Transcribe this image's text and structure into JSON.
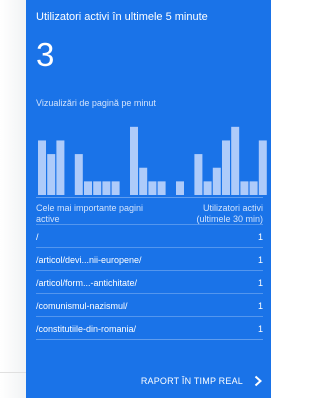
{
  "realtime": {
    "title": "Utilizatori activi în ultimele 5 minute",
    "count": "3",
    "pageviews_title": "Vizualizări de pagină pe minut",
    "table": {
      "col_left": "Cele mai importante pagini active",
      "col_right": "Utilizatori activi (ultimele 30 min)",
      "rows": [
        {
          "page": "/",
          "users": "1"
        },
        {
          "page": "/articol/devi...nii-europene/",
          "users": "1"
        },
        {
          "page": "/articol/form...-antichitate/",
          "users": "1"
        },
        {
          "page": "/comunismul-nazismul/",
          "users": "1"
        },
        {
          "page": "/constitutiile-din-romania/",
          "users": "1"
        }
      ]
    },
    "report_link": "RAPORT ÎN TIMP REAL"
  },
  "colors": {
    "card_bg": "#1a73e8",
    "bar": "#aecbfa",
    "text": "#ffffff",
    "muted_text": "#d2e3fc"
  },
  "icons": [
    "chevron-right-icon"
  ],
  "chart_data": {
    "type": "bar",
    "values": [
      4,
      3,
      4,
      0,
      3,
      1,
      1,
      1,
      1,
      0,
      5,
      2,
      1,
      1,
      0,
      1,
      0,
      3,
      1,
      2,
      4,
      5,
      1,
      1,
      4
    ],
    "ylim": [
      0,
      5.5
    ]
  }
}
